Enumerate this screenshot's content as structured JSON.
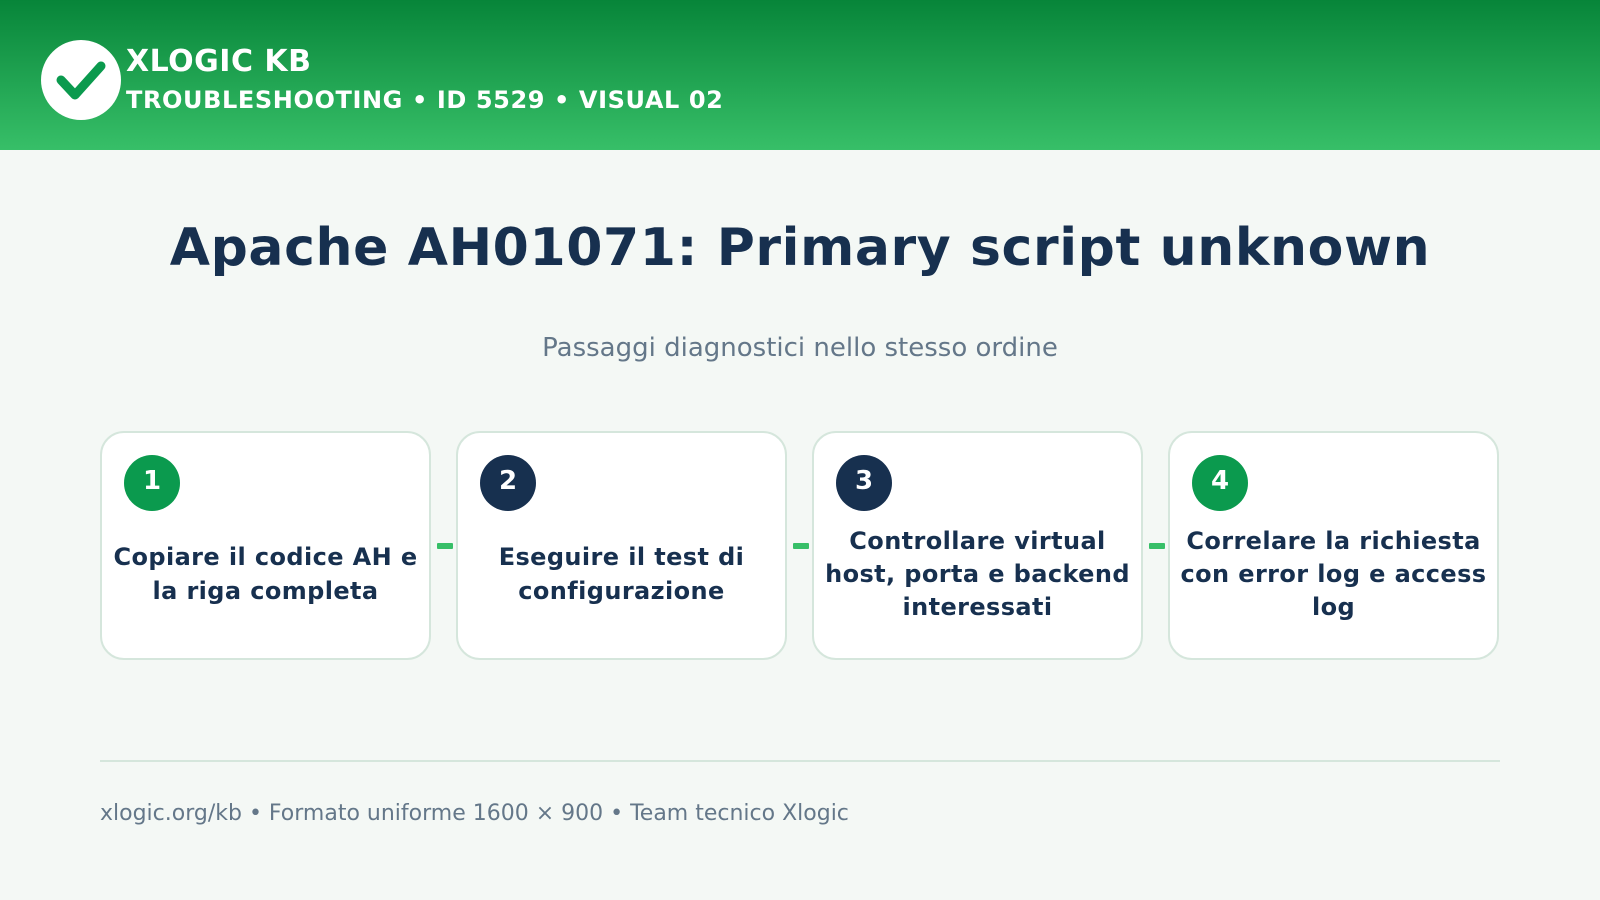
{
  "header": {
    "brand_title": "XLOGIC KB",
    "brand_subtitle": "TROUBLESHOOTING • ID 5529 • VISUAL 02",
    "logo_icon": "check-icon"
  },
  "title": "Apache AH01071: Primary script unknown",
  "subtitle": "Passaggi diagnostici nello stesso ordine",
  "steps": [
    {
      "number": "1",
      "text": "Copiare il codice AH e la riga completa",
      "badge_color": "#0b9a4e"
    },
    {
      "number": "2",
      "text": "Eseguire il test di configurazione",
      "badge_color": "#17304f"
    },
    {
      "number": "3",
      "text": "Controllare virtual host, porta e backend interessati",
      "badge_color": "#17304f"
    },
    {
      "number": "4",
      "text": "Correlare la richiesta con error log e access log",
      "badge_color": "#0b9a4e"
    }
  ],
  "footer": "xlogic.org/kb • Formato uniforme 1600 × 900 • Team tecnico Xlogic",
  "colors": {
    "header_top": "#078539",
    "header_bottom": "#37bf68",
    "accent": "#37bf68",
    "navy": "#17304f",
    "background": "#f4f8f5"
  }
}
